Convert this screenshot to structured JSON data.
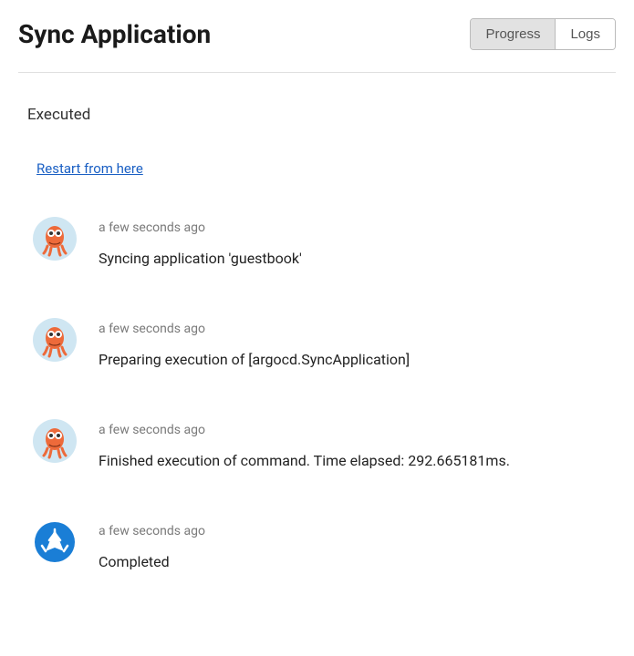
{
  "header": {
    "title": "Sync Application",
    "tabs": {
      "progress": "Progress",
      "logs": "Logs"
    }
  },
  "status": {
    "label": "Executed",
    "restart_link": "Restart from here"
  },
  "entries": [
    {
      "time": "a few seconds ago",
      "message": "Syncing application 'guestbook'",
      "avatar": "octopus"
    },
    {
      "time": "a few seconds ago",
      "message": "Preparing execution of [argocd.SyncApplication]",
      "avatar": "octopus"
    },
    {
      "time": "a few seconds ago",
      "message": "Finished execution of command. Time elapsed: 292.665181ms.",
      "avatar": "octopus"
    },
    {
      "time": "a few seconds ago",
      "message": "Completed",
      "avatar": "argo"
    }
  ]
}
